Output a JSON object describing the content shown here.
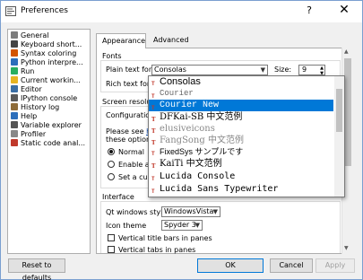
{
  "window": {
    "title": "Preferences",
    "help_glyph": "?",
    "close_glyph": "✕"
  },
  "sidebar": {
    "items": [
      {
        "label": "General",
        "color": "#7d7d7d"
      },
      {
        "label": "Keyboard short...",
        "color": "#444444"
      },
      {
        "label": "Syntax coloring",
        "color": "#d35400"
      },
      {
        "label": "Python interpre...",
        "color": "#2c6fbb"
      },
      {
        "label": "Run",
        "color": "#27ae60"
      },
      {
        "label": "Current workin...",
        "color": "#e6b422"
      },
      {
        "label": "Editor",
        "color": "#3a6ea5"
      },
      {
        "label": "IPython console",
        "color": "#5a5a5a"
      },
      {
        "label": "History log",
        "color": "#8e6c3a"
      },
      {
        "label": "Help",
        "color": "#2c6fbb"
      },
      {
        "label": "Variable explorer",
        "color": "#555555"
      },
      {
        "label": "Profiler",
        "color": "#888888"
      },
      {
        "label": "Static code anal...",
        "color": "#c0392b"
      }
    ]
  },
  "tabs": [
    {
      "label": "Appearance",
      "active": true
    },
    {
      "label": "Advanced Settings",
      "active": false
    }
  ],
  "fonts": {
    "group_label": "Fonts",
    "plain_label": "Plain text font",
    "plain_value": "Consolas",
    "size_label": "Size:",
    "size_value": "9",
    "rich_label": "Rich text font"
  },
  "screen": {
    "group_label": "Screen resolution",
    "config_label": "Configuration for",
    "note_prefix": "Please see ",
    "note_link": "http",
    "note_suffix": "these options (re",
    "radio_normal": "Normal",
    "radio_auto": "Enable auto",
    "radio_custom": "Set a custo"
  },
  "interface": {
    "group_label": "Interface",
    "qt_label": "Qt windows style",
    "qt_value": "WindowsVista",
    "icon_label": "Icon theme",
    "icon_value": "Spyder 3",
    "check_vertical_title": "Vertical title bars in panes",
    "check_vertical_tabs": "Vertical tabs in panes"
  },
  "dropdown": {
    "selected_index": 2,
    "items": [
      {
        "label": "Consolas",
        "font": "Liberation Sans",
        "size": 11,
        "color": "#000000"
      },
      {
        "label": "Courier",
        "font": "Liberation Mono",
        "size": 9,
        "color": "#666666"
      },
      {
        "label": "Courier New",
        "font": "Liberation Mono",
        "size": 10,
        "color": "#ffffff"
      },
      {
        "label": "DFKai-SB  中文范例",
        "font": "DejaVu Serif",
        "size": 10,
        "color": "#000000"
      },
      {
        "label": "elusiveicons",
        "font": "DejaVu Serif",
        "size": 10,
        "color": "#888888"
      },
      {
        "label": "FangSong  中文范例",
        "font": "DejaVu Serif",
        "size": 10,
        "color": "#888888"
      },
      {
        "label": "FixedSys  サンプルです",
        "font": "Liberation Sans",
        "size": 9,
        "color": "#000000"
      },
      {
        "label": "KaiTi  中文范例",
        "font": "DejaVu Serif",
        "size": 10,
        "color": "#000000"
      },
      {
        "label": "Lucida Console",
        "font": "DejaVu Sans Mono",
        "size": 10,
        "color": "#000000"
      },
      {
        "label": "Lucida Sans Typewriter",
        "font": "DejaVu Sans Mono",
        "size": 10,
        "color": "#000000"
      }
    ]
  },
  "buttons": {
    "reset": "Reset to defaults",
    "ok": "OK",
    "cancel": "Cancel",
    "apply": "Apply"
  }
}
